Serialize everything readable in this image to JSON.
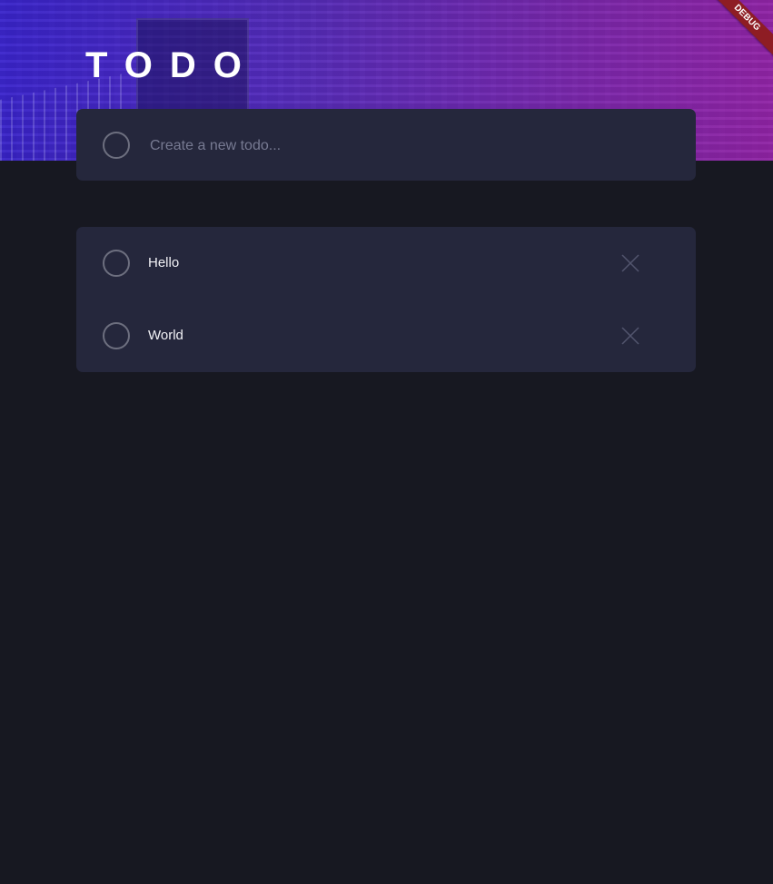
{
  "header": {
    "title": "TODO",
    "debug_banner": "DEBUG"
  },
  "new_todo": {
    "placeholder": "Create a new todo...",
    "value": ""
  },
  "todos": [
    {
      "text": "Hello",
      "completed": false
    },
    {
      "text": "World",
      "completed": false
    }
  ],
  "icons": {
    "toggle": "circle-icon",
    "delete": "close-icon"
  },
  "colors": {
    "background": "#171821",
    "card": "#25273c",
    "gradient_start": "#3a24d6",
    "gradient_end": "#9824aa",
    "debug_ribbon": "#8e1d24"
  }
}
